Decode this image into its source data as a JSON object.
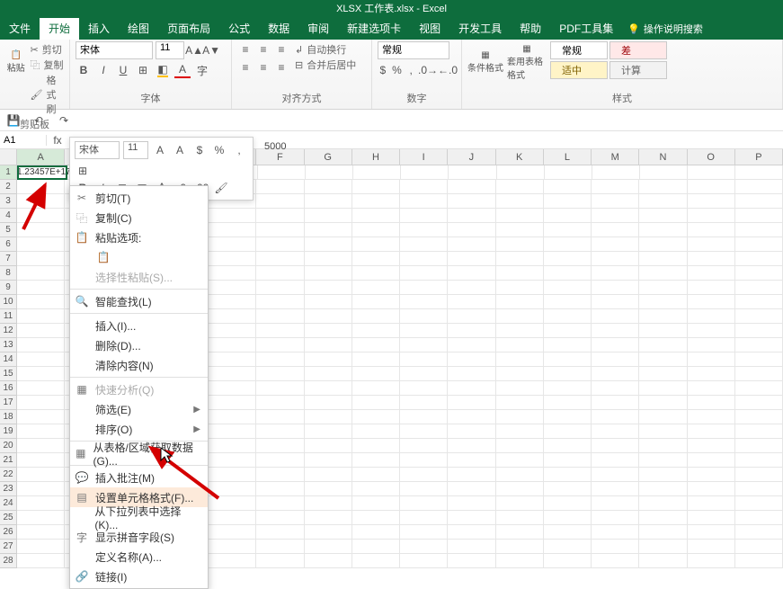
{
  "title": "XLSX 工作表.xlsx - Excel",
  "tabs": [
    "文件",
    "开始",
    "插入",
    "绘图",
    "页面布局",
    "公式",
    "数据",
    "审阅",
    "新建选项卡",
    "视图",
    "开发工具",
    "帮助",
    "PDF工具集"
  ],
  "tell_me": "操作说明搜索",
  "clipboard": {
    "paste": "粘贴",
    "cut": "剪切",
    "copy": "复制",
    "format_painter": "格式刷",
    "group": "剪贴板"
  },
  "font": {
    "name": "宋体",
    "size": "11",
    "group": "字体"
  },
  "alignment": {
    "wrap": "自动换行",
    "merge": "合并后居中",
    "group": "对齐方式"
  },
  "number": {
    "format": "常规",
    "group": "数字"
  },
  "styles": {
    "cond": "条件格式",
    "table": "套用表格格式",
    "group": "样式",
    "box1": "常规",
    "box2": "差",
    "box3": "适中",
    "box4": "计算"
  },
  "qat_namebox": "A1",
  "mini_toolbar": {
    "font": "宋体",
    "size": "11"
  },
  "formula_value": "5000",
  "cell_value": "1.23457E+17",
  "columns": [
    "A",
    "B",
    "C",
    "D",
    "E",
    "F",
    "G",
    "H",
    "I",
    "J",
    "K",
    "L",
    "M",
    "N",
    "O",
    "P"
  ],
  "row_count": 28,
  "context_menu": {
    "cut": "剪切(T)",
    "copy": "复制(C)",
    "paste_opts": "粘贴选项:",
    "paste_special": "选择性粘贴(S)...",
    "smart_lookup": "智能查找(L)",
    "insert": "插入(I)...",
    "delete": "删除(D)...",
    "clear": "清除内容(N)",
    "quick_analysis": "快速分析(Q)",
    "filter": "筛选(E)",
    "sort": "排序(O)",
    "get_data": "从表格/区域获取数据(G)...",
    "insert_comment": "插入批注(M)",
    "format_cells": "设置单元格格式(F)...",
    "pick_list": "从下拉列表中选择(K)...",
    "phonetic": "显示拼音字段(S)",
    "define_name": "定义名称(A)...",
    "link": "链接(I)"
  },
  "chart_data": null
}
